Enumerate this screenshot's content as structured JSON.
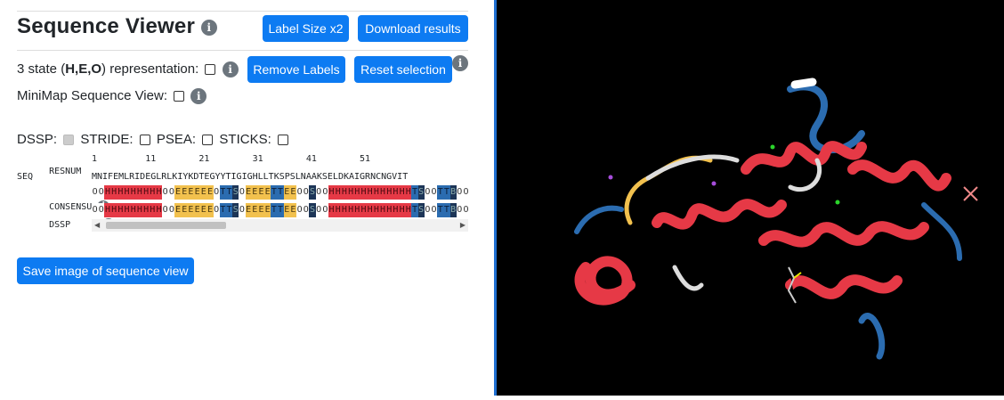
{
  "header": {
    "title": "Sequence Viewer",
    "label_size_button": "Label Size x2",
    "download_button": "Download results"
  },
  "options": {
    "state_repr_prefix": "3 state (",
    "state_repr_bold": "H,E,O",
    "state_repr_suffix": ") representation:",
    "remove_labels_button": "Remove Labels",
    "reset_selection_button": "Reset selection",
    "minimap_label": "MiniMap Sequence View:"
  },
  "methods": {
    "dssp": "DSSP:",
    "stride": "STRIDE:",
    "psea": "PSEA:",
    "sticks": "STICKS:"
  },
  "sequence": {
    "resnum_label": "RESNUM",
    "resnum_ticks": "1         11        21        31        41        51",
    "seq_label": "SEQ",
    "seq": "MNIFEMLRIDEGLRLKIYKDTEGYYTIGIGHLLTKSPSLNAAKSELDKAIGRNCNGVIT",
    "consensus_label": "CONSENSUS",
    "dssp_label": "DSSP",
    "consensus_ss": "OOHHHHHHHHHOOEEEEEEOTTSOEEEETTEEOOSOOHHHHHHHHHHHHHTSOOTTBOO",
    "dssp_ss": "OOHHHHHHHHHOOEEEEEEOTTSOEEEETTEEOOSOOHHHHHHHHHHHHHTSOOTTBOO"
  },
  "save_button": "Save image of sequence view",
  "colors": {
    "primary": "#0d7bf2",
    "helix": "#e63946",
    "strand": "#f2c14e",
    "turn": "#2b6cb0",
    "viewer_bg": "#000000"
  },
  "icons": [
    "info-icon"
  ]
}
